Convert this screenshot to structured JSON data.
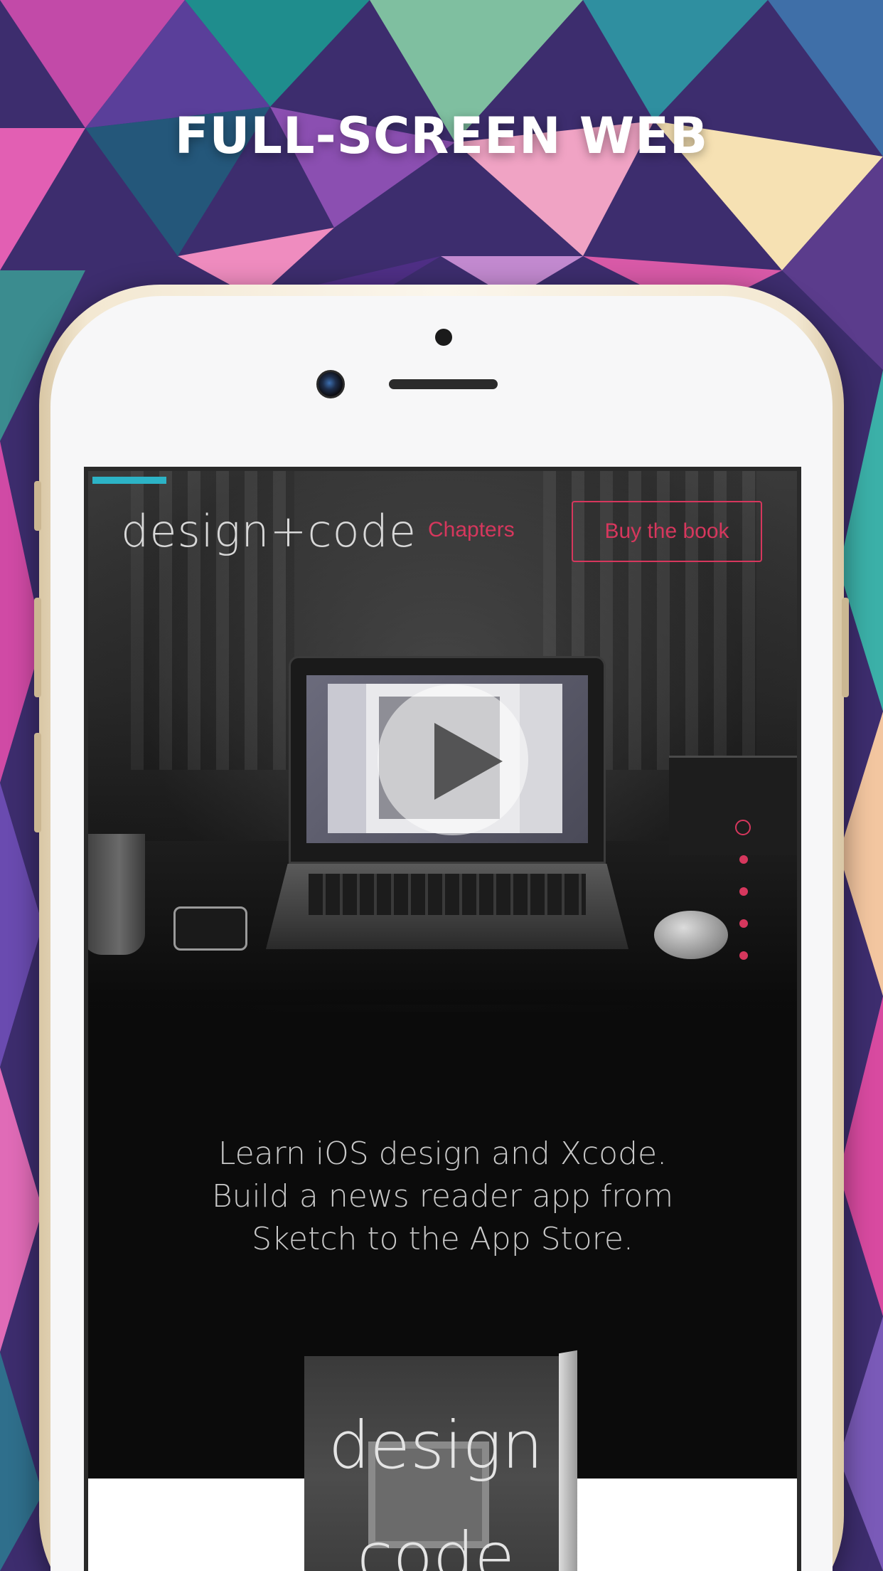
{
  "banner": {
    "headline": "FULL-SCREEN WEB"
  },
  "website": {
    "nav": {
      "logo": "design+code",
      "chapters_link": "Chapters",
      "buy_button": "Buy the book"
    },
    "hero": {
      "video": "play-icon",
      "page_indicator": {
        "total": 5,
        "active": 1
      }
    },
    "tagline": {
      "lines": [
        "Learn iOS design and Xcode.",
        "Build a news reader app from",
        "Sketch to the App Store."
      ]
    },
    "book": {
      "title_line1": "design",
      "title_line2": "code"
    }
  },
  "colors": {
    "accent_pink": "#d6375d",
    "progress_teal": "#2cb3c6",
    "phone_gold": "#e9dcc0"
  }
}
